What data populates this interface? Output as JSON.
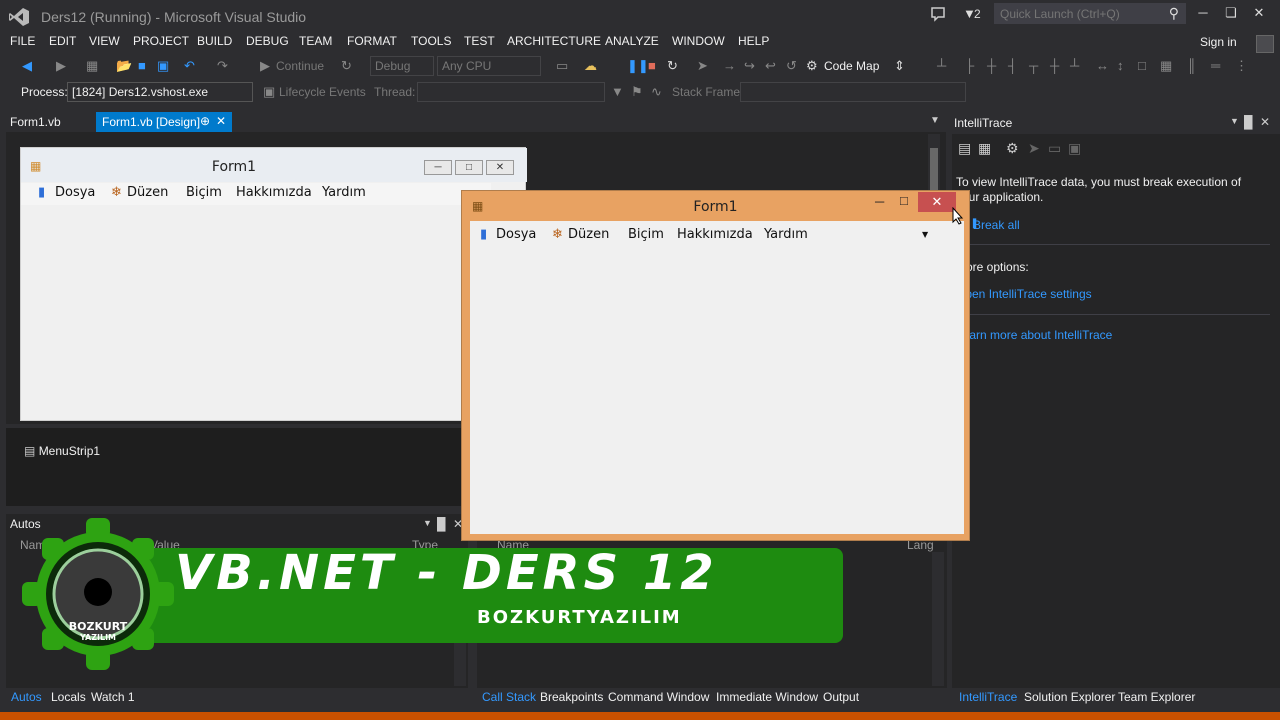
{
  "window": {
    "title": "Ders12 (Running) - Microsoft Visual Studio",
    "notification_count": "2",
    "quick_launch_placeholder": "Quick Launch (Ctrl+Q)"
  },
  "menu": [
    "FILE",
    "EDIT",
    "VIEW",
    "PROJECT",
    "BUILD",
    "DEBUG",
    "TEAM",
    "FORMAT",
    "TOOLS",
    "TEST",
    "ARCHITECTURE",
    "ANALYZE",
    "WINDOW",
    "HELP"
  ],
  "signin": "Sign in",
  "toolbar": {
    "continue": "Continue",
    "config": "Debug",
    "platform": "Any CPU",
    "code_map": "Code Map"
  },
  "debug_location": {
    "process_label": "Process:",
    "process_value": "[1824] Ders12.vshost.exe",
    "lifecycle": "Lifecycle Events",
    "thread_label": "Thread:",
    "stack_frame_label": "Stack Frame:"
  },
  "tabs": {
    "tab1": "Form1.vb",
    "tab2": "Form1.vb [Design]"
  },
  "designer_form": {
    "title": "Form1",
    "menu_items": [
      "Dosya",
      "Düzen",
      "Biçim",
      "Hakkımızda",
      "Yardım"
    ]
  },
  "component_tray": {
    "menustrip": "MenuStrip1"
  },
  "running_form": {
    "title": "Form1",
    "menu_items": [
      "Dosya",
      "Düzen",
      "Biçim",
      "Hakkımızda",
      "Yardım"
    ]
  },
  "intellitrace": {
    "title": "IntelliTrace",
    "message": "To view IntelliTrace data, you must break execution of your application.",
    "break_all": "Break all",
    "more_options": "More options:",
    "open_settings": "Open IntelliTrace settings",
    "learn_more": "Learn more about IntelliTrace"
  },
  "autos": {
    "title": "Autos",
    "col_name": "Name",
    "col_value": "Value",
    "col_type": "Type"
  },
  "callstack": {
    "col_name": "Name",
    "col_lang": "Lang"
  },
  "bottom_tabs_left": [
    "Autos",
    "Locals",
    "Watch 1"
  ],
  "bottom_tabs_mid": [
    "Call Stack",
    "Breakpoints",
    "Command Window",
    "Immediate Window",
    "Output"
  ],
  "bottom_tabs_right": [
    "IntelliTrace",
    "Solution Explorer",
    "Team Explorer"
  ],
  "banner": {
    "title": "VB.NET - DERS 12",
    "subtitle": "BOZKURTYAZILIM",
    "logo_text": [
      "BOZKURT",
      "YAZILIM"
    ]
  },
  "colors": {
    "accent": "#007acc",
    "banner_green": "#1e8b10",
    "status_orange": "#ca5100",
    "form_border": "#e8a262"
  }
}
